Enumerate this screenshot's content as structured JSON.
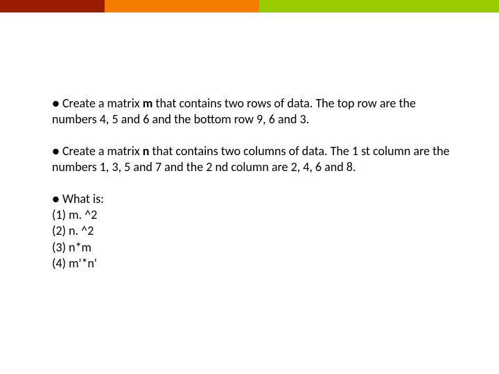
{
  "colors": {
    "red": "#991b00",
    "orange": "#f57c00",
    "green": "#99cc00"
  },
  "bullet": "●",
  "p1": {
    "pre": "Create a matrix ",
    "var": "m",
    "post": " that contains two rows of data. The top row are the numbers 4, 5 and 6 and the bottom row 9, 6 and 3."
  },
  "p2": {
    "pre": "Create a matrix ",
    "var": "n",
    "post": " that contains two columns of data. The 1 st column are the numbers 1, 3, 5 and 7 and the 2 nd column are 2, 4, 6 and 8."
  },
  "p3": {
    "lead": "What is:",
    "q1": "(1) m. ^2",
    "q2": "(2) n. ^2",
    "q3": "(3) n*m",
    "q4": "(4) m'*n'"
  }
}
